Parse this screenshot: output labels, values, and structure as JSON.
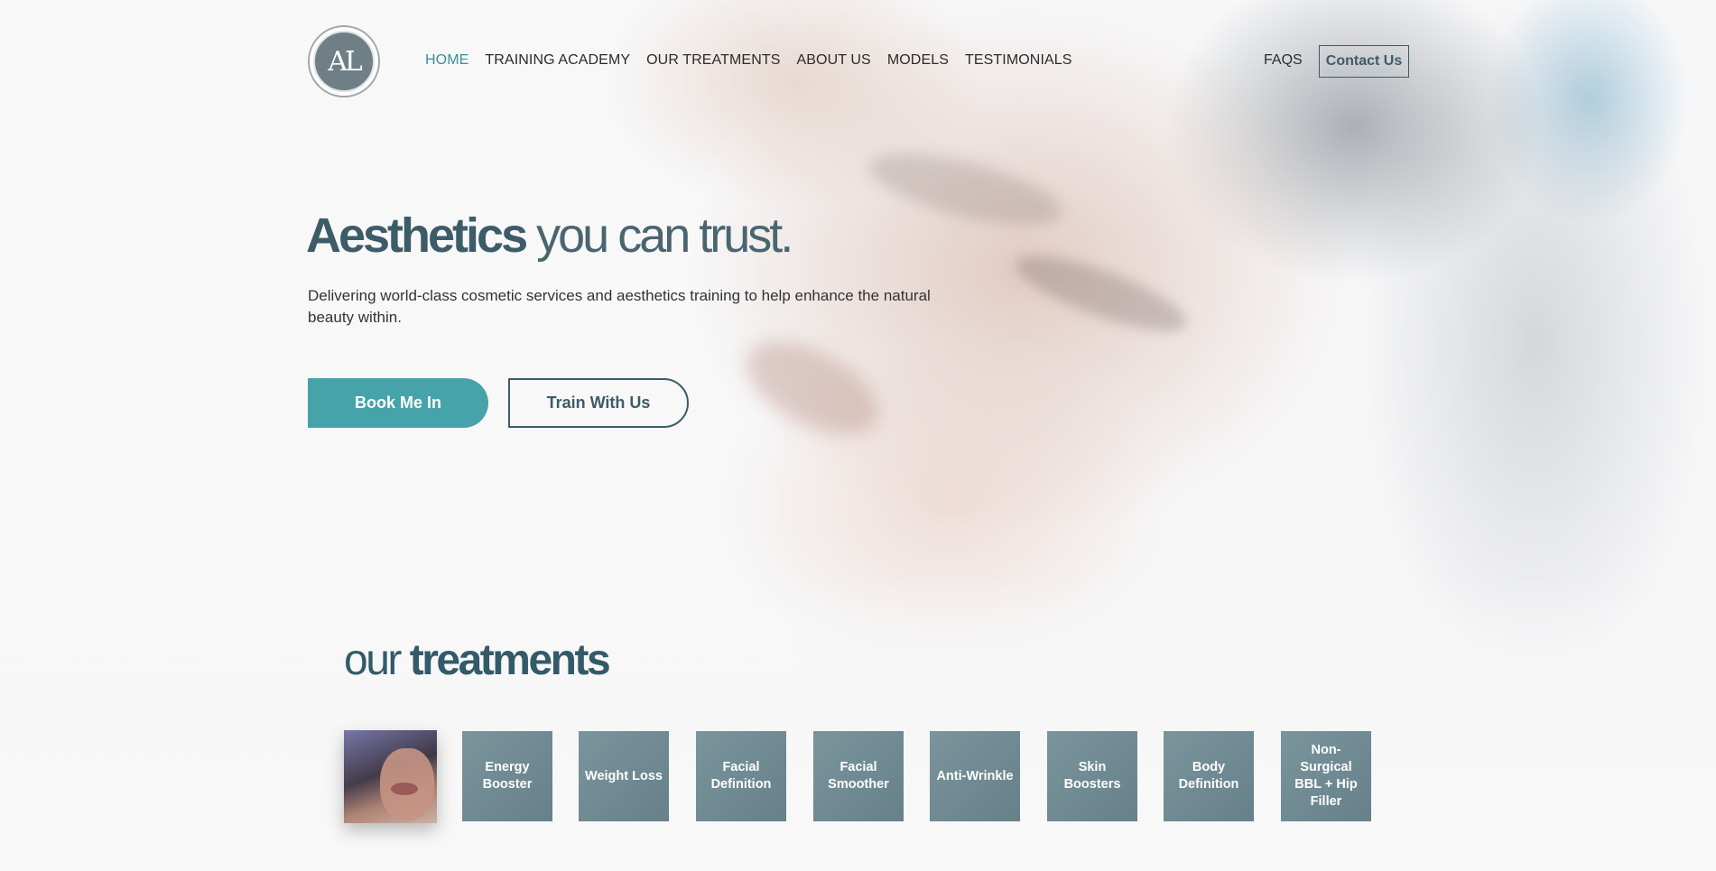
{
  "header": {
    "logo_text": "AL",
    "nav": [
      {
        "label": "HOME",
        "active": true
      },
      {
        "label": "TRAINING ACADEMY",
        "active": false
      },
      {
        "label": "OUR TREATMENTS",
        "active": false
      },
      {
        "label": "ABOUT US",
        "active": false
      },
      {
        "label": "MODELS",
        "active": false
      },
      {
        "label": "TESTIMONIALS",
        "active": false
      }
    ],
    "faqs": "FAQS",
    "contact": "Contact Us"
  },
  "hero": {
    "title_strong": "Aesthetics",
    "title_light": "you can trust.",
    "subtitle": "Delivering world-class cosmetic services and aesthetics training to help enhance the natural beauty within.",
    "primary_button": "Book Me In",
    "secondary_button": "Train With Us"
  },
  "treatments": {
    "title_light": "our",
    "title_strong": "treatments",
    "tiles": [
      {
        "label": ""
      },
      {
        "label": "Energy Booster"
      },
      {
        "label": "Weight Loss"
      },
      {
        "label": "Facial Definition"
      },
      {
        "label": "Facial Smoother"
      },
      {
        "label": "Anti-Wrinkle"
      },
      {
        "label": "Skin Boosters"
      },
      {
        "label": "Body Definition"
      },
      {
        "label": "Non-Surgical BBL + Hip Filler"
      }
    ]
  },
  "colors": {
    "accent": "#47a3aa",
    "dark_teal": "#3d5c68",
    "nav_active": "#3a8f99"
  }
}
